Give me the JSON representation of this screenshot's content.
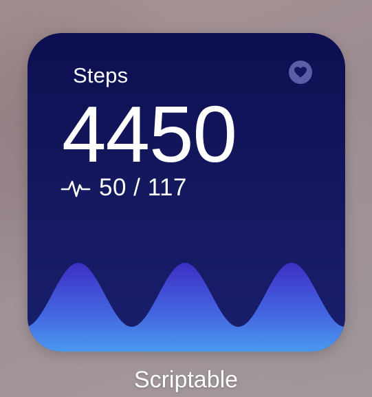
{
  "widget": {
    "title": "Steps",
    "steps_value": "4450",
    "heart_rate_text": "50 / 117",
    "icons": {
      "favorite": "heart-icon",
      "heart_rate": "pulse-icon"
    },
    "colors": {
      "background_top": "#0e0f52",
      "wave_top": "#3d2fc4",
      "wave_bottom": "#4a98ef",
      "badge": "#5a5ea6"
    }
  },
  "app": {
    "name": "Scriptable"
  }
}
